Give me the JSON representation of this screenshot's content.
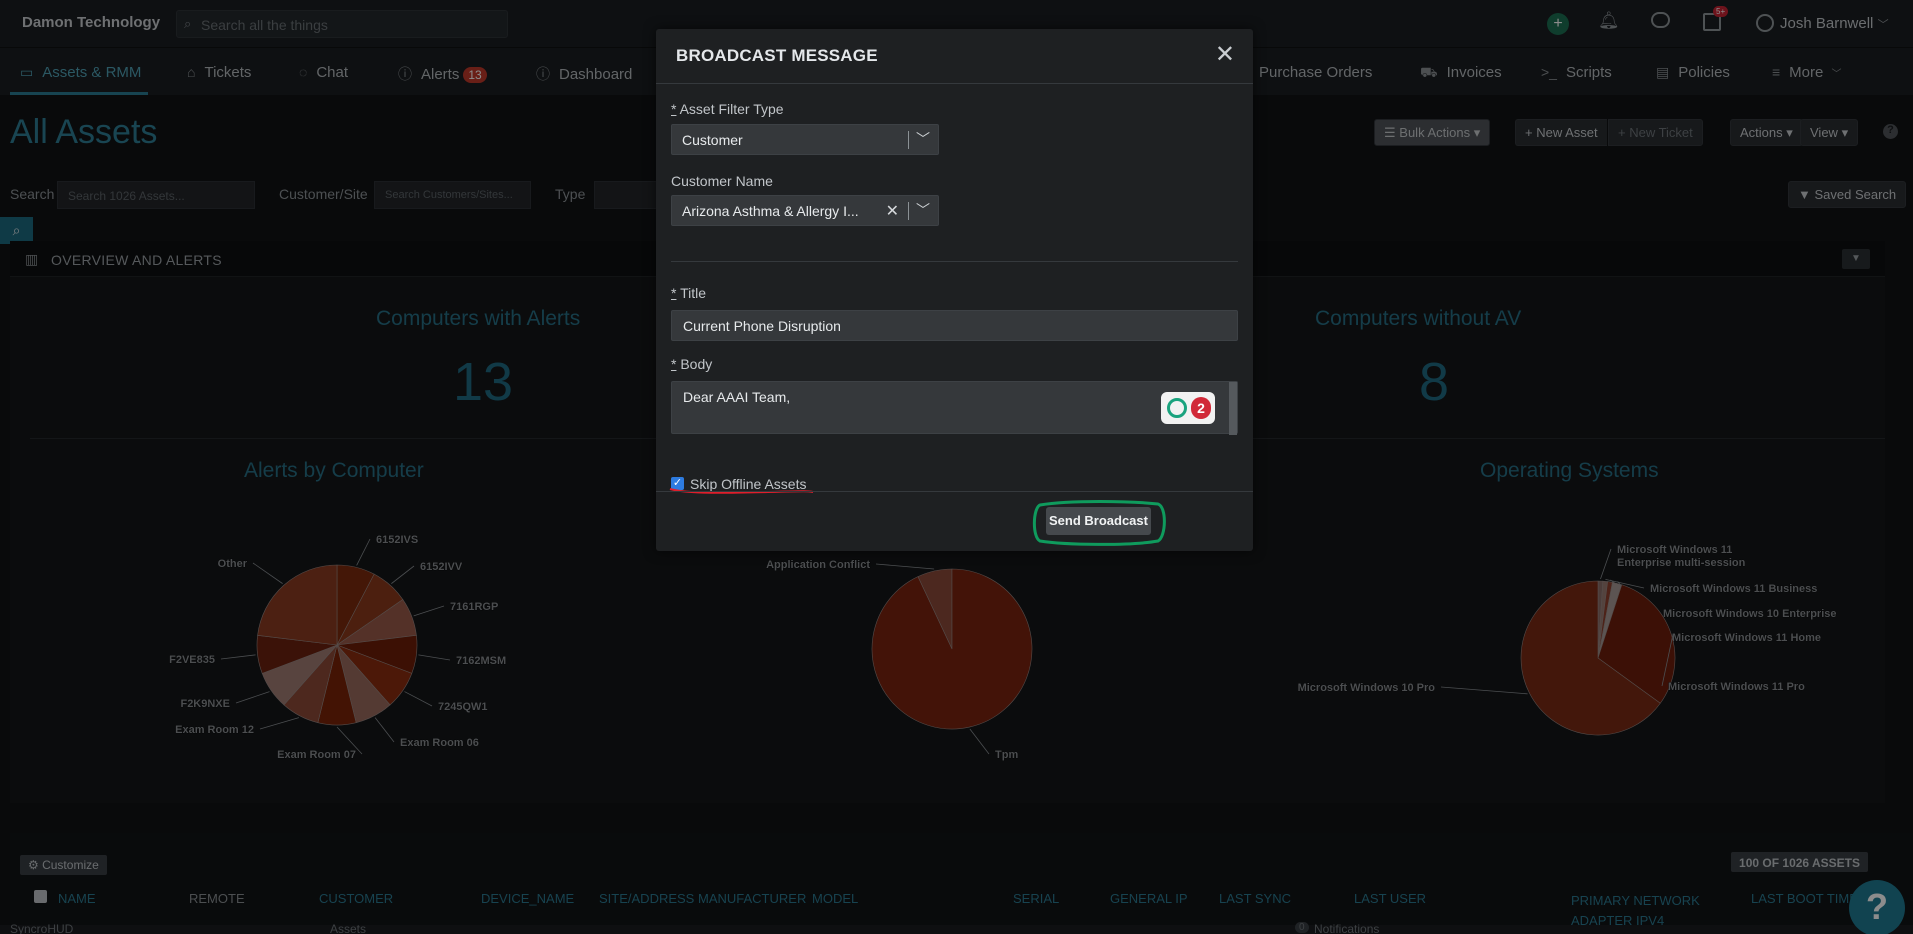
{
  "topbar": {
    "brand": "Damon Technology",
    "search_placeholder": "Search all the things",
    "notif_badge": "5+",
    "user_name": "Josh Barnwell"
  },
  "nav": {
    "items": [
      {
        "label": "Assets & RMM",
        "icon": "desktop-icon"
      },
      {
        "label": "Tickets",
        "icon": "tag-icon"
      },
      {
        "label": "Chat",
        "icon": "chat-icon"
      },
      {
        "label": "Alerts",
        "icon": "alert-circle-icon",
        "badge": "13"
      },
      {
        "label": "Dashboard",
        "icon": "info-icon"
      },
      {
        "label": "Purchase Orders",
        "icon": "folder-icon"
      },
      {
        "label": "Invoices",
        "icon": "cart-icon"
      },
      {
        "label": "Scripts",
        "icon": "terminal-icon"
      },
      {
        "label": "Policies",
        "icon": "document-icon"
      },
      {
        "label": "More",
        "icon": "menu-icon"
      }
    ]
  },
  "page": {
    "title": "All Assets",
    "bulk_actions": "Bulk Actions",
    "new_asset": "+ New Asset",
    "new_ticket": "+ New Ticket",
    "actions": "Actions",
    "view": "View",
    "saved_search": "Saved Search",
    "search_label": "Search",
    "search_placeholder": "Search 1026 Assets...",
    "customer_site_label": "Customer/Site",
    "customer_site_placeholder": "Search Customers/Sites...",
    "type_label": "Type"
  },
  "overview": {
    "title": "OVERVIEW AND ALERTS",
    "stats": [
      {
        "label": "Computers with Alerts",
        "value": "13"
      },
      {
        "label": "Computers without AV",
        "value": "8"
      }
    ],
    "chart_titles": {
      "alerts_by_computer": "Alerts by Computer",
      "operating_systems": "Operating Systems"
    }
  },
  "chart_data": [
    {
      "type": "pie",
      "title": "Alerts by Computer",
      "slices": [
        {
          "label": "6152IVS",
          "value": 1
        },
        {
          "label": "6152IVV",
          "value": 1
        },
        {
          "label": "7161RGP",
          "value": 1
        },
        {
          "label": "7162MSM",
          "value": 1
        },
        {
          "label": "7245QW1",
          "value": 1
        },
        {
          "label": "Exam Room 06",
          "value": 1
        },
        {
          "label": "Exam Room 07",
          "value": 1
        },
        {
          "label": "Exam Room 12",
          "value": 1
        },
        {
          "label": "F2K9NXE",
          "value": 1
        },
        {
          "label": "F2VE835",
          "value": 1
        },
        {
          "label": "Other",
          "value": 3
        }
      ]
    },
    {
      "type": "pie",
      "title": "",
      "slices": [
        {
          "label": "Application Conflict",
          "value": 7
        },
        {
          "label": "Tpm",
          "value": 93
        }
      ]
    },
    {
      "type": "pie",
      "title": "Operating Systems",
      "slices": [
        {
          "label": "Microsoft Windows 11 Enterprise multi-session",
          "value": 1
        },
        {
          "label": "Microsoft Windows 11 Business",
          "value": 1
        },
        {
          "label": "Microsoft Windows 10 Enterprise",
          "value": 1
        },
        {
          "label": "Microsoft Windows 11 Home",
          "value": 2
        },
        {
          "label": "Microsoft Windows 11 Pro",
          "value": 30
        },
        {
          "label": "Microsoft Windows 10 Pro",
          "value": 65
        }
      ]
    }
  ],
  "table": {
    "customize": "Customize",
    "count": "100 OF 1026 ASSETS",
    "columns": [
      "NAME",
      "REMOTE",
      "CUSTOMER",
      "DEVICE_NAME",
      "SITE/ADDRESS",
      "MANUFACTURER",
      "MODEL",
      "SERIAL",
      "GENERAL IP",
      "LAST SYNC",
      "LAST USER",
      "PRIMARY NETWORK ADAPTER IPV4",
      "LAST BOOT TIME"
    ]
  },
  "statusbar": {
    "left": "SyncroHUD",
    "middle": "Assets",
    "notif_count": "0",
    "notifications": "Notifications"
  },
  "modal": {
    "title": "BROADCAST MESSAGE",
    "asset_filter_label": "Asset Filter Type",
    "asset_filter_value": "Customer",
    "customer_name_label": "Customer Name",
    "customer_name_value": "Arizona Asthma & Allergy I...",
    "title_label": "Title",
    "title_value": "Current Phone Disruption",
    "body_label": "Body",
    "body_value": "Dear AAAI Team,",
    "grammar_count": "2",
    "skip_offline_label": "Skip Offline Assets",
    "send_button": "Send Broadcast",
    "required_mark": "*"
  },
  "colors": {
    "accent": "#2e7f96",
    "pie_main": "#7a2a12",
    "annotation_red": "#e01e2b",
    "annotation_green": "#0f9b5d"
  }
}
